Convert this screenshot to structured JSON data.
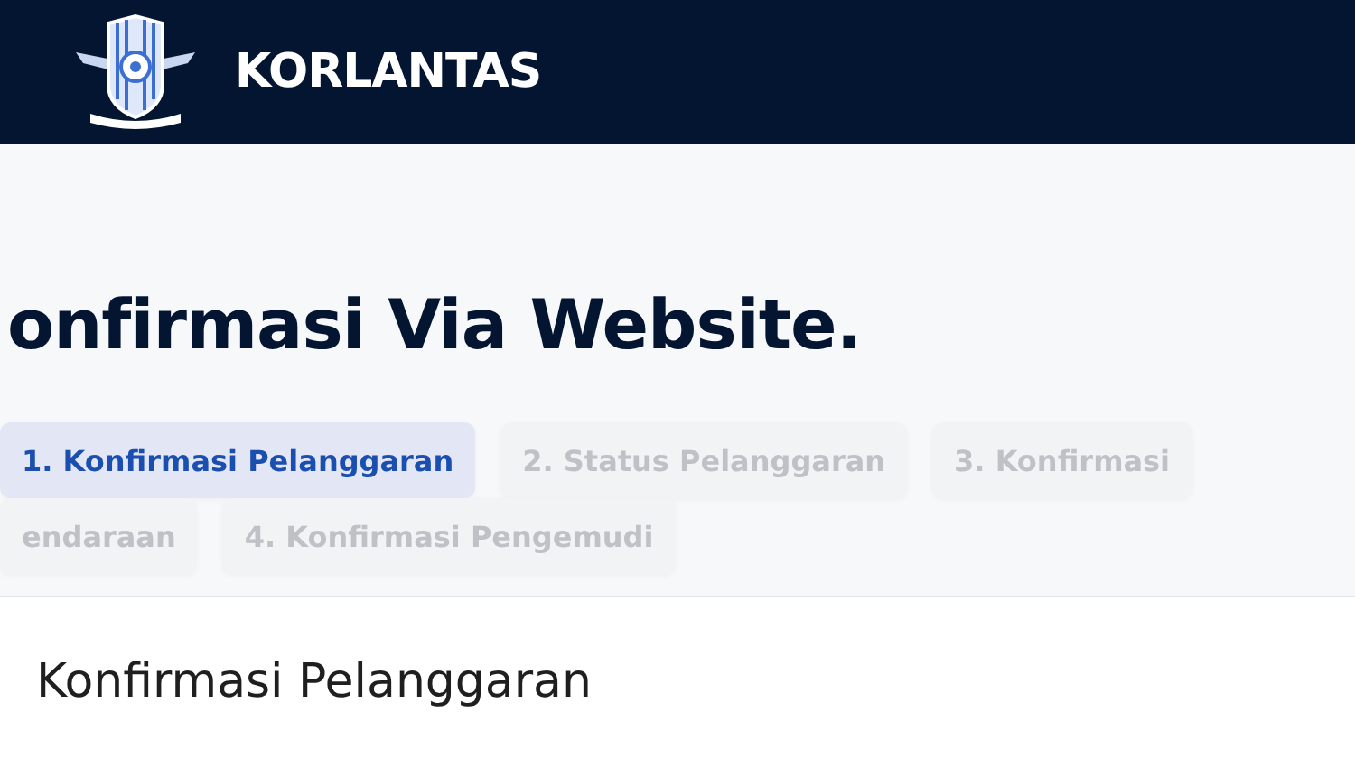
{
  "header": {
    "brand": "KORLANTAS"
  },
  "page_title": "onfirmasi Via Website.",
  "tabs": [
    {
      "label": "1. Konfirmasi Pelanggaran",
      "selected": true
    },
    {
      "label": "2. Status Pelanggaran",
      "selected": false
    },
    {
      "label": "3. Konfirmasi",
      "selected": false
    },
    {
      "label": "endaraan",
      "selected": false
    },
    {
      "label": "4. Konfirmasi Pengemudi",
      "selected": false
    }
  ],
  "section": {
    "heading": "Konfirmasi Pelanggaran"
  }
}
